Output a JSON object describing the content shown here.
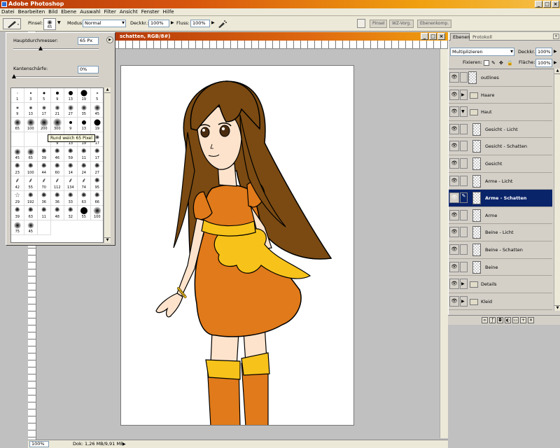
{
  "app": {
    "title": "Adobe Photoshop",
    "window_controls": {
      "min": "_",
      "max": "□",
      "close": "×"
    }
  },
  "menu": [
    "Datei",
    "Bearbeiten",
    "Bild",
    "Ebene",
    "Auswahl",
    "Filter",
    "Ansicht",
    "Fenster",
    "Hilfe"
  ],
  "options_bar": {
    "brush_label": "Pinsel:",
    "brush_size": "65",
    "mode_label": "Modus:",
    "mode_value": "Normal",
    "opacity_label": "Deckkr.:",
    "opacity_value": "100%",
    "flow_label": "Fluss:",
    "flow_value": "100%",
    "well_tabs": [
      "Pinsel",
      "WZ-Vorg.",
      "Ebenenkomp."
    ]
  },
  "document": {
    "title": "schatten, RGB/8#)"
  },
  "brush_panel": {
    "diameter_label": "Hauptdurchmesser:",
    "diameter_value": "65 Px",
    "hardness_label": "Kantenschärfe:",
    "hardness_value": "0%",
    "tooltip": "Rund weich 65 Pixel",
    "brushes": [
      {
        "label": "1",
        "kind": "hard",
        "size": 1
      },
      {
        "label": "3",
        "kind": "hard",
        "size": 2
      },
      {
        "label": "5",
        "kind": "hard",
        "size": 3
      },
      {
        "label": "9",
        "kind": "hard",
        "size": 4
      },
      {
        "label": "13",
        "kind": "hard",
        "size": 6
      },
      {
        "label": "19",
        "kind": "hard",
        "size": 9
      },
      {
        "label": "5",
        "kind": "soft",
        "size": 3
      },
      {
        "label": "9",
        "kind": "soft",
        "size": 4
      },
      {
        "label": "13",
        "kind": "soft",
        "size": 5
      },
      {
        "label": "17",
        "kind": "soft",
        "size": 6
      },
      {
        "label": "21",
        "kind": "soft",
        "size": 7
      },
      {
        "label": "27",
        "kind": "soft",
        "size": 8
      },
      {
        "label": "35",
        "kind": "soft",
        "size": 8
      },
      {
        "label": "45",
        "kind": "soft",
        "size": 9
      },
      {
        "label": "65",
        "kind": "soft",
        "size": 10
      },
      {
        "label": "100",
        "kind": "soft",
        "size": 11
      },
      {
        "label": "200",
        "kind": "soft",
        "size": 12
      },
      {
        "label": "300",
        "kind": "soft",
        "size": 12
      },
      {
        "label": "9",
        "kind": "hard",
        "size": 4
      },
      {
        "label": "13",
        "kind": "hard",
        "size": 6
      },
      {
        "label": "19",
        "kind": "hard",
        "size": 9
      },
      {
        "label": "",
        "kind": "none",
        "size": 0
      },
      {
        "label": "",
        "kind": "none",
        "size": 0
      },
      {
        "label": "",
        "kind": "none",
        "size": 0
      },
      {
        "label": "9",
        "kind": "soft",
        "size": 4
      },
      {
        "label": "13",
        "kind": "soft",
        "size": 5
      },
      {
        "label": "19",
        "kind": "soft",
        "size": 6
      },
      {
        "label": "17",
        "kind": "soft",
        "size": 6
      },
      {
        "label": "45",
        "kind": "soft",
        "size": 9
      },
      {
        "label": "65",
        "kind": "soft",
        "size": 10
      },
      {
        "label": "39",
        "kind": "splat",
        "size": 9
      },
      {
        "label": "46",
        "kind": "splat",
        "size": 9
      },
      {
        "label": "59",
        "kind": "splat",
        "size": 9
      },
      {
        "label": "11",
        "kind": "splat",
        "size": 7
      },
      {
        "label": "17",
        "kind": "splat",
        "size": 7
      },
      {
        "label": "23",
        "kind": "splat",
        "size": 8
      },
      {
        "label": "100",
        "kind": "splat",
        "size": 9
      },
      {
        "label": "44",
        "kind": "splat",
        "size": 9
      },
      {
        "label": "60",
        "kind": "splat",
        "size": 9
      },
      {
        "label": "14",
        "kind": "splat",
        "size": 7
      },
      {
        "label": "24",
        "kind": "splat",
        "size": 8
      },
      {
        "label": "27",
        "kind": "splat",
        "size": 8
      },
      {
        "label": "42",
        "kind": "grass",
        "size": 9
      },
      {
        "label": "55",
        "kind": "grass",
        "size": 9
      },
      {
        "label": "70",
        "kind": "grass",
        "size": 9
      },
      {
        "label": "112",
        "kind": "grass",
        "size": 9
      },
      {
        "label": "134",
        "kind": "grass",
        "size": 9
      },
      {
        "label": "74",
        "kind": "grass",
        "size": 9
      },
      {
        "label": "95",
        "kind": "splat",
        "size": 9
      },
      {
        "label": "29",
        "kind": "star",
        "size": 9
      },
      {
        "label": "192",
        "kind": "splat",
        "size": 9
      },
      {
        "label": "36",
        "kind": "splat",
        "size": 9
      },
      {
        "label": "36",
        "kind": "splat",
        "size": 9
      },
      {
        "label": "33",
        "kind": "splat",
        "size": 9
      },
      {
        "label": "63",
        "kind": "splat",
        "size": 9
      },
      {
        "label": "66",
        "kind": "splat",
        "size": 9
      },
      {
        "label": "39",
        "kind": "splat",
        "size": 9
      },
      {
        "label": "63",
        "kind": "splat",
        "size": 9
      },
      {
        "label": "11",
        "kind": "splat",
        "size": 7
      },
      {
        "label": "48",
        "kind": "splat",
        "size": 9
      },
      {
        "label": "32",
        "kind": "splat",
        "size": 9
      },
      {
        "label": "55",
        "kind": "hard",
        "size": 10
      },
      {
        "label": "100",
        "kind": "soft",
        "size": 11
      },
      {
        "label": "75",
        "kind": "soft",
        "size": 10
      },
      {
        "label": "45",
        "kind": "soft",
        "size": 9
      },
      {
        "label": "",
        "kind": "none",
        "size": 0
      }
    ]
  },
  "layers_panel": {
    "tabs": [
      "Ebenen",
      "Protokoll"
    ],
    "blend_mode": "Multiplizieren",
    "opacity_label": "Deckkr.:",
    "opacity_value": "100%",
    "lock_label": "Fixieren:",
    "fill_label": "Fläche:",
    "fill_value": "100%",
    "layers": [
      {
        "name": "outlines",
        "type": "layer",
        "indent": 0,
        "selected": false
      },
      {
        "name": "Haare",
        "type": "group",
        "indent": 0,
        "selected": false,
        "expanded": false
      },
      {
        "name": "Haut",
        "type": "group",
        "indent": 0,
        "selected": false,
        "expanded": true
      },
      {
        "name": "Gesicht - Licht",
        "type": "layer",
        "indent": 1,
        "selected": false
      },
      {
        "name": "Gesicht - Schatten",
        "type": "layer",
        "indent": 1,
        "selected": false
      },
      {
        "name": "Gesicht",
        "type": "layer",
        "indent": 1,
        "selected": false
      },
      {
        "name": "Arme - Licht",
        "type": "layer",
        "indent": 1,
        "selected": false
      },
      {
        "name": "Arme - Schatten",
        "type": "layer",
        "indent": 1,
        "selected": true
      },
      {
        "name": "Arme",
        "type": "layer",
        "indent": 1,
        "selected": false
      },
      {
        "name": "Beine - Licht",
        "type": "layer",
        "indent": 1,
        "selected": false
      },
      {
        "name": "Beine - Schatten",
        "type": "layer",
        "indent": 1,
        "selected": false
      },
      {
        "name": "Beine",
        "type": "layer",
        "indent": 1,
        "selected": false
      },
      {
        "name": "Details",
        "type": "group",
        "indent": 0,
        "selected": false,
        "expanded": false
      },
      {
        "name": "Kleid",
        "type": "group",
        "indent": 0,
        "selected": false,
        "expanded": false
      }
    ]
  },
  "status": {
    "zoom": "100%",
    "doc": "Dok: 1,26 MB/9,91 MB"
  },
  "colors": {
    "hair": "#7a4a12",
    "dress": "#e07a1a",
    "bow": "#f7c31a",
    "skin": "#fde3cc",
    "selected_layer": "#0a246a"
  }
}
